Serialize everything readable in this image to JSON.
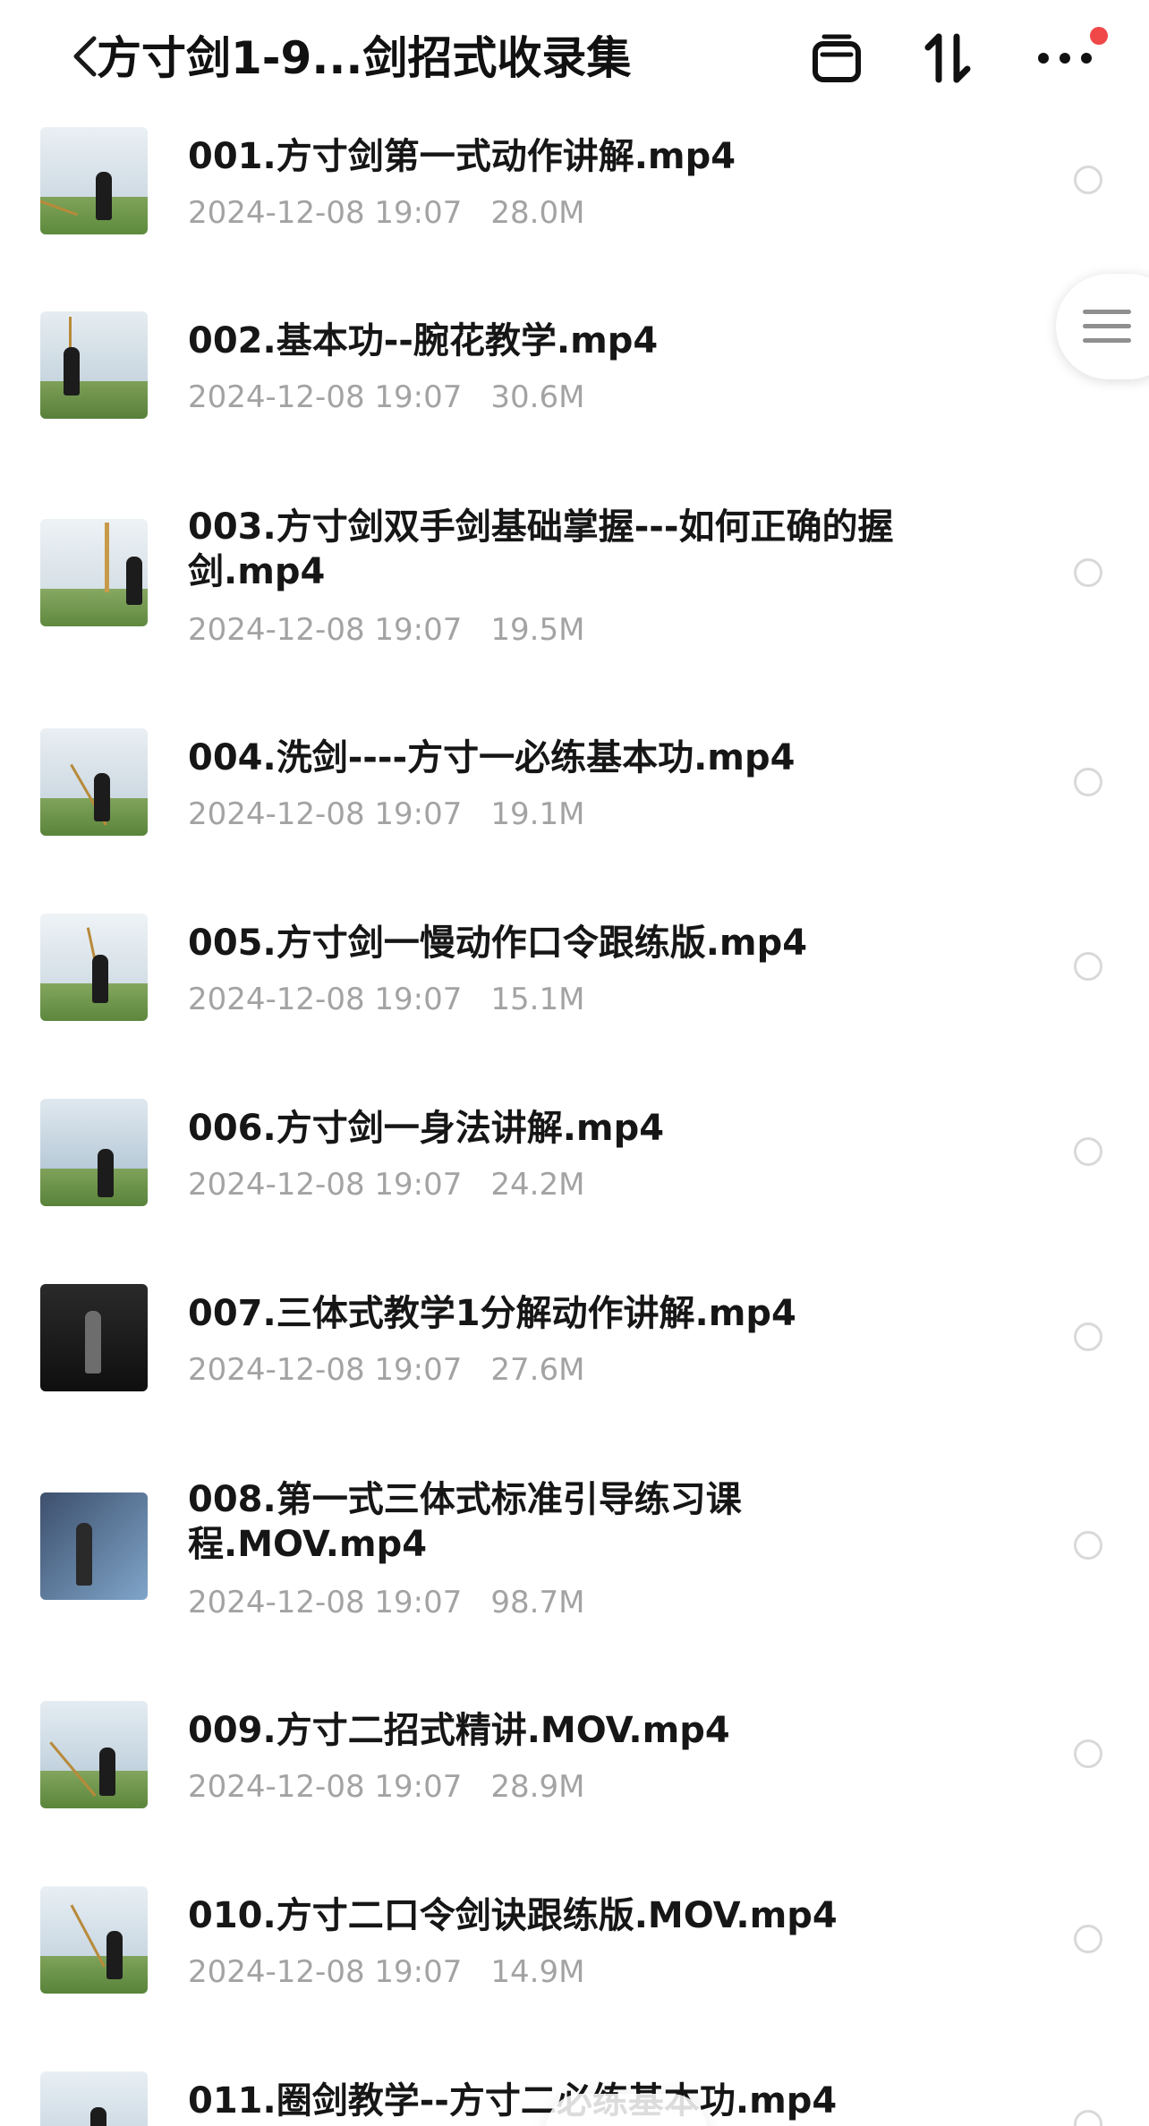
{
  "header": {
    "title": "方寸剑1-9...剑招式收录集",
    "icons": [
      "back-chevron-icon",
      "window-icon",
      "sort-icon",
      "more-icon"
    ],
    "notification_dot_color": "#f04848"
  },
  "side_handle": {
    "icon": "list-lines-icon"
  },
  "files": [
    {
      "name": "001.方寸剑第一式动作讲解.mp4",
      "date": "2024-12-08 19:07",
      "size": "28.0M",
      "thumb": "field"
    },
    {
      "name": "002.基本功--腕花教学.mp4",
      "date": "2024-12-08 19:07",
      "size": "30.6M",
      "thumb": "field"
    },
    {
      "name": "003.方寸剑双手剑基础掌握---如何正确的握剑.mp4",
      "date": "2024-12-08 19:07",
      "size": "19.5M",
      "thumb": "field"
    },
    {
      "name": "004.洗剑----方寸一必练基本功.mp4",
      "date": "2024-12-08 19:07",
      "size": "19.1M",
      "thumb": "field"
    },
    {
      "name": "005.方寸剑一慢动作口令跟练版.mp4",
      "date": "2024-12-08 19:07",
      "size": "15.1M",
      "thumb": "field"
    },
    {
      "name": "006.方寸剑一身法讲解.mp4",
      "date": "2024-12-08 19:07",
      "size": "24.2M",
      "thumb": "field"
    },
    {
      "name": "007.三体式教学1分解动作讲解.mp4",
      "date": "2024-12-08 19:07",
      "size": "27.6M",
      "thumb": "dark"
    },
    {
      "name": "008.第一式三体式标准引导练习课程.MOV.mp4",
      "date": "2024-12-08 19:07",
      "size": "98.7M",
      "thumb": "blue"
    },
    {
      "name": "009.方寸二招式精讲.MOV.mp4",
      "date": "2024-12-08 19:07",
      "size": "28.9M",
      "thumb": "field"
    },
    {
      "name": "010.方寸二口令剑诀跟练版.MOV.mp4",
      "date": "2024-12-08 19:07",
      "size": "14.9M",
      "thumb": "field"
    },
    {
      "name": "011.圈剑教学--方寸二必练基本功.mp4",
      "date": "",
      "size": "",
      "thumb": "field"
    }
  ],
  "colors": {
    "text_primary": "#161616",
    "text_secondary": "#a3a3a3",
    "radio_border": "#d9d9d9"
  }
}
